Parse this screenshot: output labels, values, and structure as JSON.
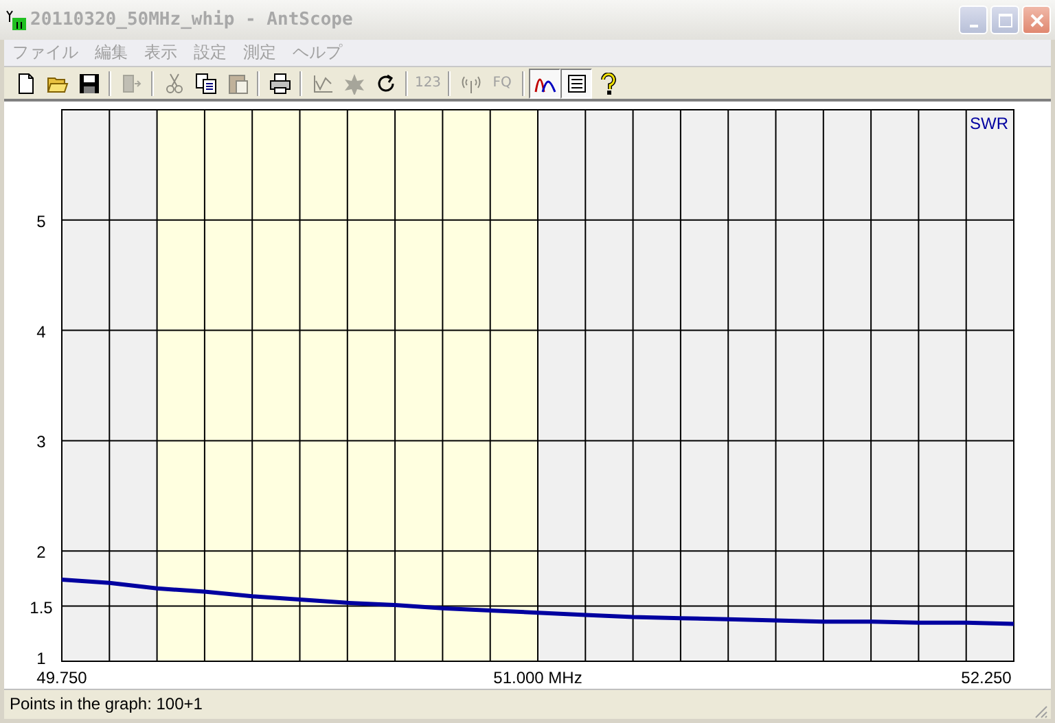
{
  "window": {
    "title": "20110320_50MHz_whip - AntScope"
  },
  "menu": [
    "ファイル",
    "編集",
    "表示",
    "設定",
    "測定",
    "ヘルプ"
  ],
  "toolbar": [
    {
      "kind": "icon",
      "disabled": false,
      "pressed": false
    },
    {
      "kind": "icon",
      "disabled": false,
      "pressed": false
    },
    {
      "kind": "icon",
      "disabled": false,
      "pressed": false
    },
    {
      "kind": "separator"
    },
    {
      "kind": "icon",
      "disabled": true,
      "pressed": false
    },
    {
      "kind": "separator"
    },
    {
      "kind": "icon",
      "disabled": true,
      "pressed": false
    },
    {
      "kind": "icon",
      "disabled": false,
      "pressed": false
    },
    {
      "kind": "icon",
      "disabled": true,
      "pressed": false
    },
    {
      "kind": "separator"
    },
    {
      "kind": "icon",
      "disabled": false,
      "pressed": false
    },
    {
      "kind": "separator"
    },
    {
      "kind": "icon",
      "disabled": true,
      "pressed": false
    },
    {
      "kind": "icon",
      "disabled": true,
      "pressed": false
    },
    {
      "kind": "icon",
      "disabled": false,
      "pressed": false
    },
    {
      "kind": "separator"
    },
    {
      "kind": "text",
      "label": "123",
      "disabled": true,
      "pressed": false
    },
    {
      "kind": "separator"
    },
    {
      "kind": "icon",
      "disabled": true,
      "pressed": false
    },
    {
      "kind": "text",
      "label": "FQ",
      "disabled": true,
      "pressed": false
    },
    {
      "kind": "separator"
    },
    {
      "kind": "icon",
      "disabled": false,
      "pressed": true
    },
    {
      "kind": "icon",
      "disabled": false,
      "pressed": true
    },
    {
      "kind": "icon",
      "disabled": false,
      "pressed": false
    }
  ],
  "chart": {
    "chart_data": {
      "type": "line",
      "x": [
        49.75,
        49.875,
        50.0,
        50.125,
        50.25,
        50.375,
        50.5,
        50.625,
        50.75,
        50.875,
        51.0,
        51.125,
        51.25,
        51.375,
        51.5,
        51.625,
        51.75,
        51.875,
        52.0,
        52.125,
        52.25
      ],
      "series": [
        {
          "name": "SWR",
          "color": "#0000a0",
          "values": [
            1.74,
            1.71,
            1.66,
            1.63,
            1.59,
            1.56,
            1.53,
            1.51,
            1.48,
            1.46,
            1.44,
            1.42,
            1.4,
            1.39,
            1.38,
            1.37,
            1.36,
            1.36,
            1.35,
            1.35,
            1.34
          ]
        }
      ],
      "xlim": [
        49.75,
        52.25
      ],
      "ylim": [
        1,
        6
      ],
      "xticks": [
        {
          "value": 49.75,
          "label": "49.750"
        },
        {
          "value": 51.0,
          "label": "51.000 MHz"
        },
        {
          "value": 52.25,
          "label": "52.250"
        }
      ],
      "yticks": [
        {
          "value": 1,
          "label": "1"
        },
        {
          "value": 1.5,
          "label": "1.5"
        },
        {
          "value": 2,
          "label": "2"
        },
        {
          "value": 3,
          "label": "3"
        },
        {
          "value": 4,
          "label": "4"
        },
        {
          "value": 5,
          "label": "5"
        }
      ],
      "grid": true,
      "bands": [
        {
          "axis": "x",
          "from": 50.0,
          "to": 51.0,
          "color": "#ffffe0"
        }
      ]
    }
  },
  "status_bar": "Points in the graph: 100+1"
}
